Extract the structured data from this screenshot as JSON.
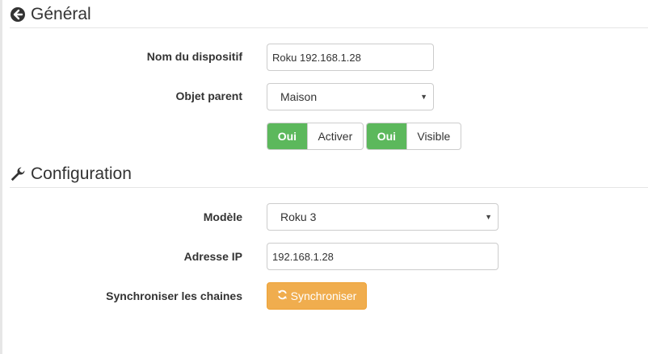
{
  "general": {
    "title": "Général",
    "icon": "arrow-circle-left-icon",
    "device_name_label": "Nom du dispositif",
    "device_name_value": "Roku 192.168.1.28",
    "parent_label": "Objet parent",
    "parent_value": "Maison",
    "activate_toggle": {
      "on_label": "Oui",
      "off_label": "Activer"
    },
    "visible_toggle": {
      "on_label": "Oui",
      "off_label": "Visible"
    }
  },
  "configuration": {
    "title": "Configuration",
    "icon": "wrench-icon",
    "model_label": "Modèle",
    "model_value": "Roku 3",
    "ip_label": "Adresse IP",
    "ip_value": "192.168.1.28",
    "sync_label": "Synchroniser les chaines",
    "sync_button": "Synchroniser",
    "sync_icon": "refresh-icon"
  },
  "colors": {
    "success": "#5cb85c",
    "warning": "#f0ad4e",
    "border": "#cccccc"
  }
}
